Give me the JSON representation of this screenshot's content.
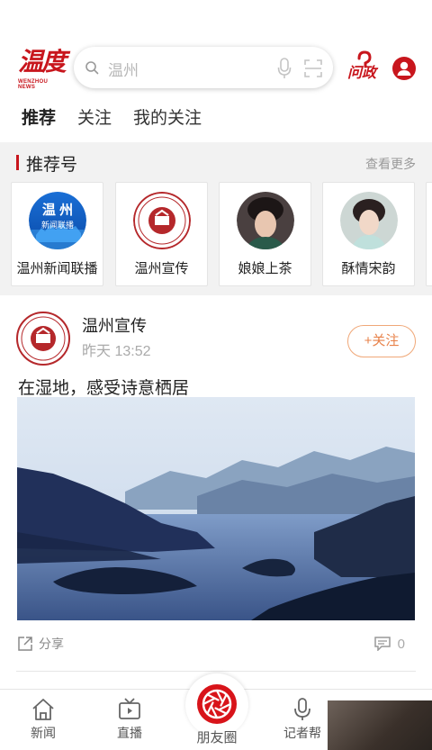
{
  "header": {
    "logo_text": "温度",
    "logo_subtext": "WENZHOU NEWS",
    "search_placeholder": "温州",
    "ask_label": "问政"
  },
  "tabs": [
    {
      "label": "推荐",
      "active": true
    },
    {
      "label": "关注",
      "active": false
    },
    {
      "label": "我的关注",
      "active": false
    }
  ],
  "recommended": {
    "title": "推荐号",
    "more_label": "查看更多",
    "accounts": [
      {
        "name": "温州新闻联播",
        "avatar_text": "温州\n新闻联播"
      },
      {
        "name": "温州宣传"
      },
      {
        "name": "娘娘上茶"
      },
      {
        "name": "酥情宋韵"
      }
    ]
  },
  "post": {
    "author": "温州宣传",
    "time": "昨天  13:52",
    "follow_label": "+关注",
    "title": "在湿地，感受诗意栖居",
    "share_label": "分享",
    "comment_count": "0"
  },
  "bottom_nav": {
    "items": [
      {
        "label": "新闻",
        "icon": "home-icon"
      },
      {
        "label": "直播",
        "icon": "tv-icon"
      },
      {
        "label": "朋友圈",
        "icon": "shutter-icon"
      },
      {
        "label": "记者帮",
        "icon": "mic-icon"
      }
    ]
  },
  "colors": {
    "brand_red": "#c8161d",
    "follow_orange": "#e8824a",
    "section_bg": "#f2f2f2"
  }
}
